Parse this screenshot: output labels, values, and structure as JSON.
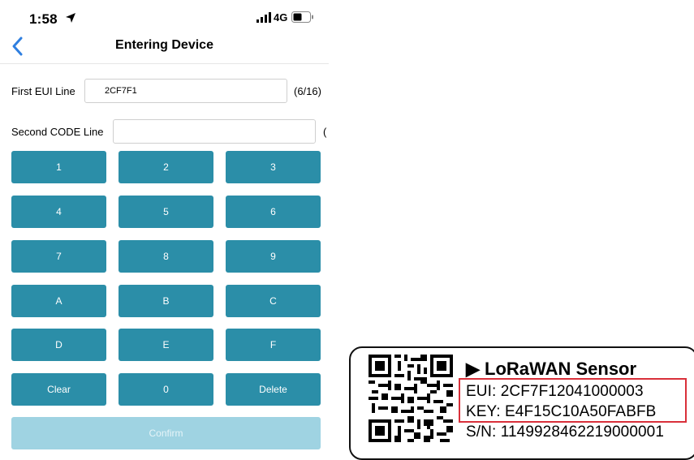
{
  "status_bar": {
    "time": "1:58",
    "network": "4G"
  },
  "nav": {
    "title": "Entering Device"
  },
  "first_eui": {
    "label": "First EUI Line",
    "value": "2CF7F1",
    "count": "(6/16)"
  },
  "second_code": {
    "label": "Second CODE Line",
    "value": "",
    "count": "("
  },
  "keypad": {
    "rows": [
      [
        "1",
        "2",
        "3"
      ],
      [
        "4",
        "5",
        "6"
      ],
      [
        "7",
        "8",
        "9"
      ],
      [
        "A",
        "B",
        "C"
      ],
      [
        "D",
        "E",
        "F"
      ],
      [
        "Clear",
        "0",
        "Delete"
      ]
    ],
    "confirm_label": "Confirm"
  },
  "label_card": {
    "title": "▶ LoRaWAN Sensor",
    "eui": "EUI: 2CF7F12041000003",
    "key": "KEY: E4F15C10A50FABFB",
    "sn": "S/N: 114992846221900000​1"
  },
  "colors": {
    "key_bg": "#2b8ea8",
    "confirm_bg": "#9fd3e2",
    "highlight": "#d9303a",
    "back_arrow": "#2f7fe0"
  }
}
